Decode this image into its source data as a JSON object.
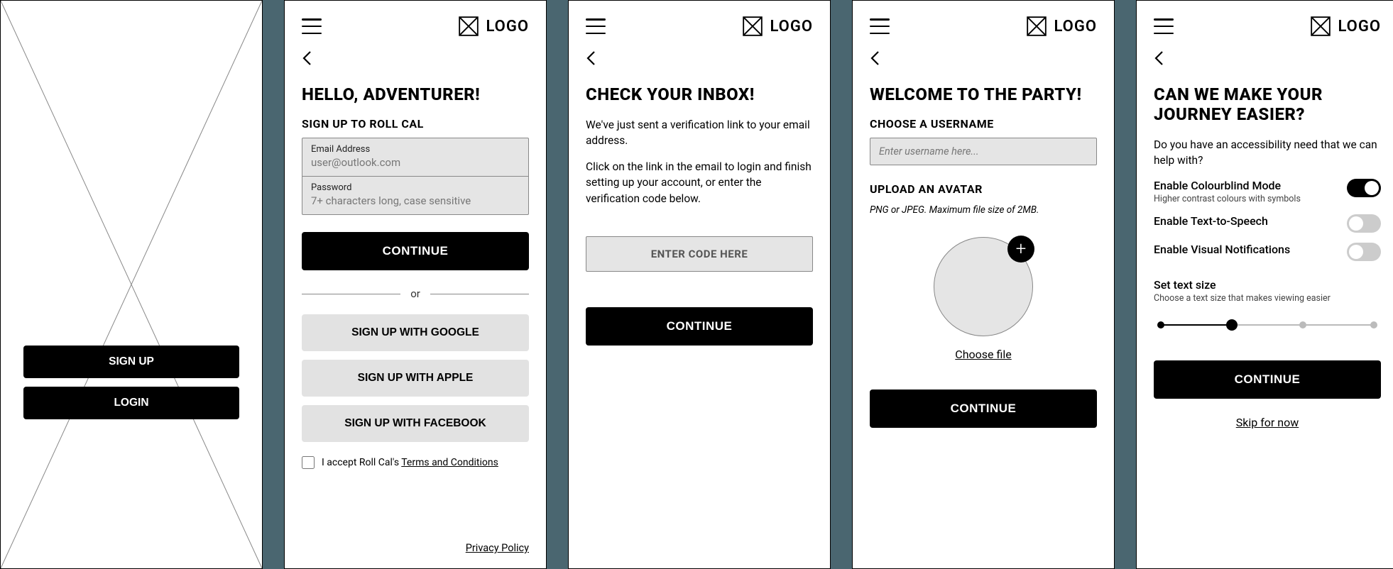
{
  "splash": {
    "signup": "SIGN UP",
    "login": "LOGIN"
  },
  "header": {
    "logo": "LOGO"
  },
  "screen2": {
    "title": "HELLO, ADVENTURER!",
    "subtitle": "SIGN UP TO ROLL CAL",
    "email_label": "Email Address",
    "email_placeholder": "user@outlook.com",
    "password_label": "Password",
    "password_placeholder": "7+ characters long, case sensitive",
    "continue": "CONTINUE",
    "or": "or",
    "google": "SIGN UP WITH GOOGLE",
    "apple": "SIGN UP WITH APPLE",
    "facebook": "SIGN UP WITH FACEBOOK",
    "accept_prefix": "I accept Roll Cal's ",
    "tnc": "Terms and Conditions",
    "privacy": "Privacy Policy"
  },
  "screen3": {
    "title": "CHECK YOUR INBOX!",
    "p1": "We've just sent a verification link to your email address.",
    "p2": "Click on the link in the email to login and finish setting up your account, or enter the verification code below.",
    "code_ph": "ENTER CODE HERE",
    "continue": "CONTINUE"
  },
  "screen4": {
    "title": "WELCOME TO THE PARTY!",
    "username_label": "CHOOSE A USERNAME",
    "username_ph": "Enter username here...",
    "upload_label": "UPLOAD AN AVATAR",
    "upload_hint": "PNG or JPEG. Maximum file size of 2MB.",
    "choose_file": "Choose file",
    "continue": "CONTINUE"
  },
  "screen5": {
    "title": "CAN WE MAKE YOUR JOURNEY EASIER?",
    "intro": "Do you have an accessibility need that we can help with?",
    "cb_label": "Enable Colourblind Mode",
    "cb_sub": "Higher contrast colours with symbols",
    "tts_label": "Enable Text-to-Speech",
    "vis_label": "Enable Visual Notifications",
    "text_size_label": "Set text size",
    "text_size_sub": "Choose a text size that makes viewing easier",
    "slider_stops": 4,
    "slider_value": 1,
    "continue": "CONTINUE",
    "skip": "Skip for now"
  }
}
